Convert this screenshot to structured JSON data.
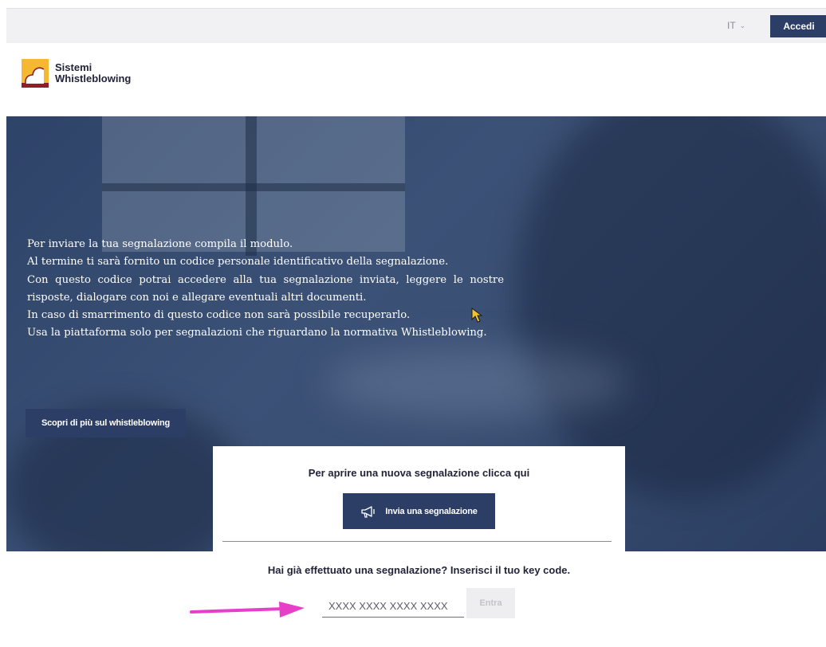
{
  "header": {
    "language": "IT",
    "login_label": "Accedi"
  },
  "logo": {
    "line1": "Sistemi",
    "line2": "Whistleblowing"
  },
  "hero": {
    "paragraphs": [
      "Per inviare la tua segnalazione compila il modulo.",
      "Al termine ti sarà  fornito un codice personale identificativo della segnalazione.",
      "Con questo codice potrai accedere alla tua segnalazione inviata, leggere le nostre risposte, dialogare con noi e allegare eventuali altri documenti.",
      "In caso di smarrimento di questo codice non sarà  possibile recuperarlo.",
      "Usa la piattaforma solo per segnalazioni che riguardano la normativa Whistleblowing."
    ],
    "learn_more_label": "Scopri di più sul whistleblowing"
  },
  "card": {
    "new_report_prompt": "Per aprire una nuova segnalazione clicca qui",
    "send_report_label": "Invia una segnalazione",
    "send_report_icon": "megaphone-icon",
    "existing_report_prompt": "Hai già effettuato una segnalazione? Inserisci il tuo key code.",
    "key_code_placeholder": "XXXX XXXX XXXX XXXX",
    "enter_label": "Entra"
  },
  "colors": {
    "primary": "#2c3e66",
    "annotation_arrow": "#e83fc8"
  }
}
